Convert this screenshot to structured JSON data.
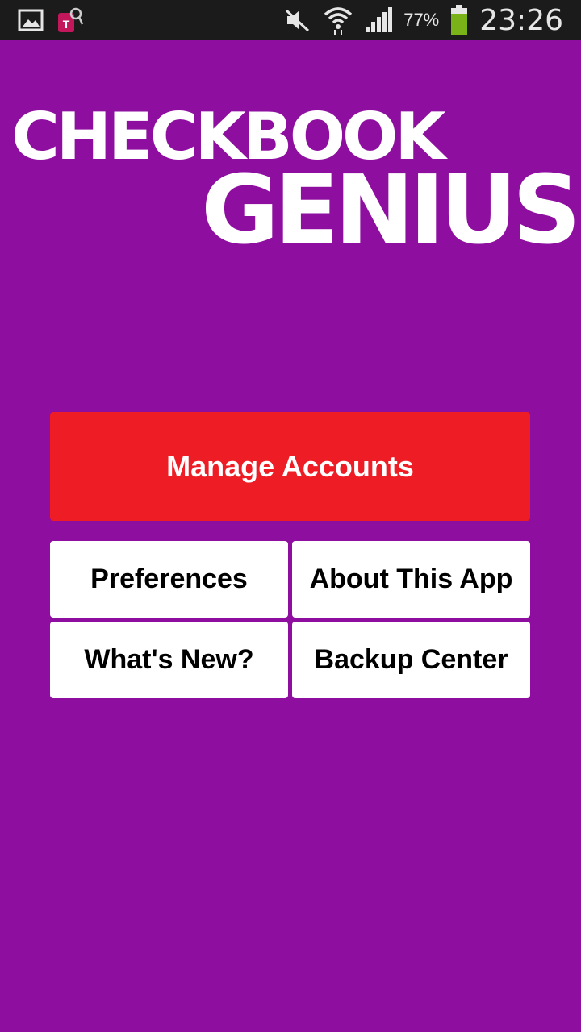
{
  "status_bar": {
    "icons_left": [
      "gallery-icon",
      "tmobile-icon"
    ],
    "icons_right": [
      "mute-icon",
      "wifi-icon",
      "signal-icon",
      "battery-icon"
    ],
    "battery_percent": "77%",
    "time": "23:26"
  },
  "logo": {
    "line1": "CHECKBOOK",
    "line2": "GENIUS"
  },
  "menu": {
    "manage_accounts": "Manage Accounts",
    "preferences": "Preferences",
    "about": "About This App",
    "whats_new": "What's New?",
    "backup_center": "Backup Center"
  },
  "colors": {
    "background": "#8e0e9f",
    "primary_button": "#ee1c25",
    "secondary_button": "#ffffff",
    "battery_fill": "#7ab317"
  }
}
